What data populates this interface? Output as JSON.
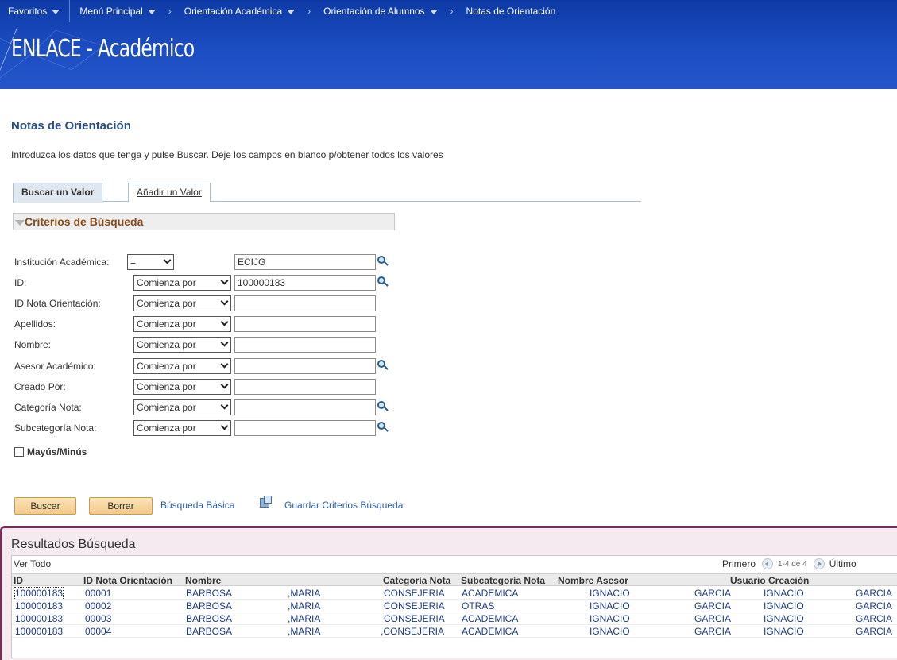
{
  "nav": {
    "favorites": "Favoritos",
    "main_menu": "Menú Principal",
    "crumb1": "Orientación Académica",
    "crumb2": "Orientación de Alumnos",
    "crumb3": "Notas de Orientación"
  },
  "brand": {
    "logo_text": "ENLACE - Académico"
  },
  "page": {
    "title": "Notas de Orientación",
    "instructions": "Introduzca los datos que tenga y pulse Buscar. Deje los campos en blanco p/obtener todos los valores"
  },
  "tabs": {
    "find": "Buscar un Valor",
    "add": "Añadir un Valor"
  },
  "criteria": {
    "title": "Criterios de Búsqueda",
    "fields": [
      {
        "label": "Institución Académica:",
        "operator": "=",
        "value": "ECIJG"
      },
      {
        "label": "ID:",
        "operator": "Comienza por",
        "value": "100000183"
      },
      {
        "label": "ID Nota Orientación:",
        "operator": "Comienza por",
        "value": ""
      },
      {
        "label": "Apellidos:",
        "operator": "Comienza por",
        "value": ""
      },
      {
        "label": "Nombre:",
        "operator": "Comienza por",
        "value": ""
      },
      {
        "label": "Asesor Académico:",
        "operator": "Comienza por",
        "value": ""
      },
      {
        "label": "Creado Por:",
        "operator": "Comienza por",
        "value": ""
      },
      {
        "label": "Categoría Nota:",
        "operator": "Comienza por",
        "value": ""
      },
      {
        "label": "Subcategoría Nota:",
        "operator": "Comienza por",
        "value": ""
      }
    ],
    "case_sensitive": "Mayús/Minús"
  },
  "actions": {
    "search": "Buscar",
    "clear": "Borrar",
    "basic_search": "Búsqueda Básica",
    "save_criteria": "Guardar Criterios Búsqueda"
  },
  "results": {
    "title": "Resultados Búsqueda",
    "view_all": "Ver Todo",
    "first": "Primero",
    "count": "1-4 de 4",
    "last": "Último",
    "columns": [
      "ID",
      "ID Nota Orientación",
      "Nombre",
      "Categoría Nota",
      "Subcategoría Nota",
      "Nombre Asesor",
      "Usuario Creación"
    ],
    "rows": [
      {
        "id": "100000183",
        "note": "00001",
        "last": "BARBOSA",
        "first": ",MARIA",
        "cat": "CONSEJERIA",
        "sub": "ACADEMICA",
        "adv_first": "IGNACIO",
        "adv_last": "GARCIA",
        "user_first": "IGNACIO",
        "user_last": "GARCIA"
      },
      {
        "id": "100000183",
        "note": "00002",
        "last": "BARBOSA",
        "first": ",MARIA",
        "cat": "CONSEJERIA",
        "sub": "OTRAS",
        "adv_first": "IGNACIO",
        "adv_last": "GARCIA",
        "user_first": "IGNACIO",
        "user_last": "GARCIA"
      },
      {
        "id": "100000183",
        "note": "00003",
        "last": "BARBOSA",
        "first": ",MARIA",
        "cat": "CONSEJERIA",
        "sub": "ACADEMICA",
        "adv_first": "IGNACIO",
        "adv_last": "GARCIA",
        "user_first": "IGNACIO",
        "user_last": "GARCIA"
      },
      {
        "id": "100000183",
        "note": "00004",
        "last": "BARBOSA",
        "first": ",MARIA",
        "cat": ",CONSEJERIA",
        "sub": "ACADEMICA",
        "adv_first": "IGNACIO",
        "adv_last": "GARCIA",
        "user_first": "IGNACIO",
        "user_last": "GARCIA"
      }
    ]
  },
  "colors": {
    "header_blue": "#1d4fc4",
    "title_blue": "#2a5087",
    "criteria_brown": "#8a4a1a",
    "results_border": "#7b2a5a"
  }
}
